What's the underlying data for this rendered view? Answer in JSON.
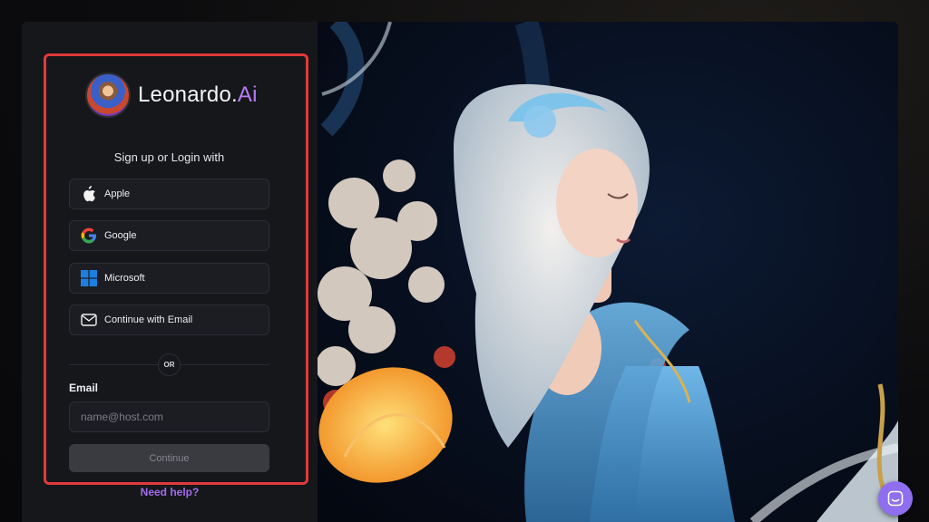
{
  "brand": {
    "name_prefix": "Leonardo.",
    "name_accent": "Ai"
  },
  "login": {
    "heading": "Sign up or Login with",
    "providers": [
      {
        "label": "Apple",
        "icon": "apple-icon"
      },
      {
        "label": "Google",
        "icon": "google-icon"
      },
      {
        "label": "Microsoft",
        "icon": "microsoft-icon"
      },
      {
        "label": "Continue with Email",
        "icon": "mail-icon"
      }
    ],
    "divider_text": "OR",
    "email_label": "Email",
    "email_placeholder": "name@host.com",
    "email_value": "",
    "continue_label": "Continue",
    "help_link": "Need help?"
  },
  "chat_widget": {
    "icon": "chat-icon"
  },
  "colors": {
    "highlight_border": "#e03a3a",
    "brand_accent": "#b67cf5",
    "link": "#a46bf0",
    "chat_button": "#8f6ff0"
  }
}
